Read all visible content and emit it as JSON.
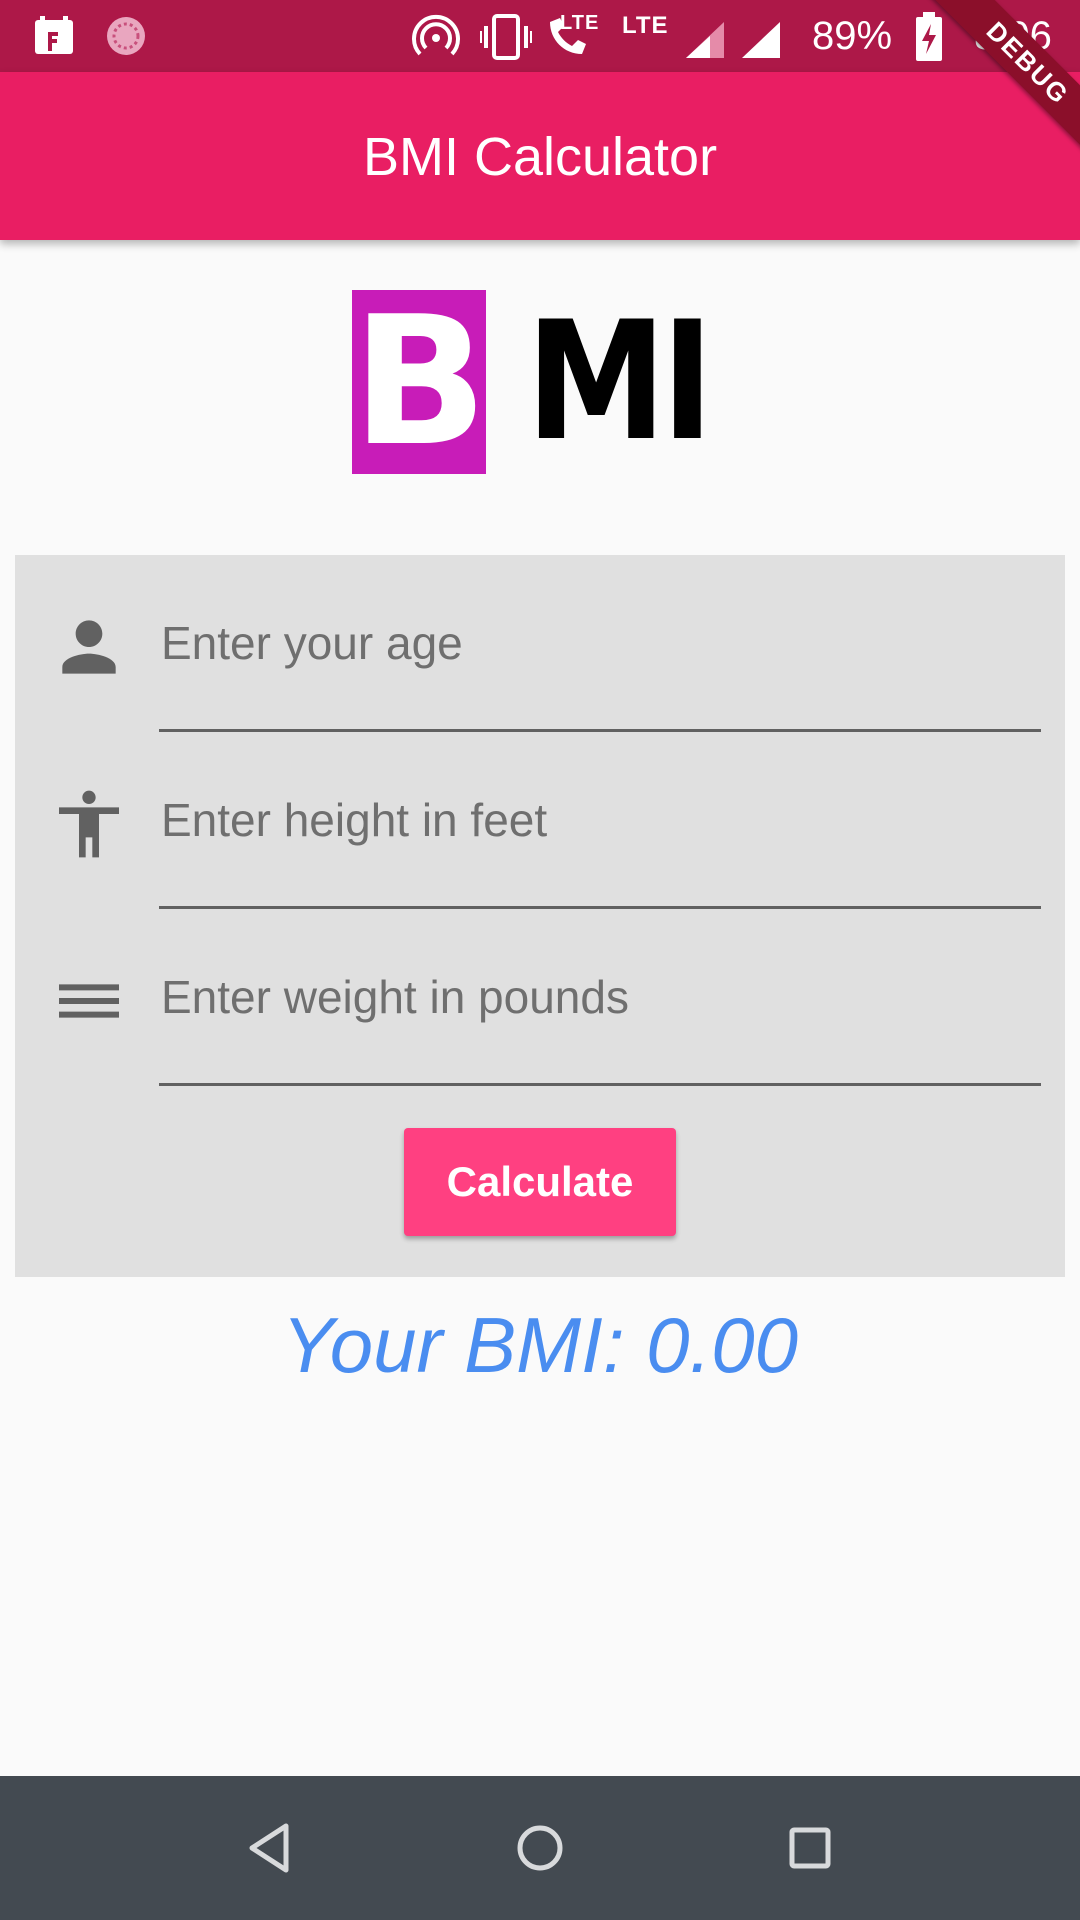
{
  "status_bar": {
    "battery_percent": "89%",
    "time": "8:06",
    "network_labels": [
      "LTE",
      "LTE"
    ]
  },
  "debug_banner": {
    "label": "DEBUG"
  },
  "app_bar": {
    "title": "BMI Calculator"
  },
  "logo": {
    "letter_b": "B",
    "letters_mi": "MI"
  },
  "form": {
    "fields": [
      {
        "placeholder": "Enter your age",
        "value": "",
        "icon": "person-icon"
      },
      {
        "placeholder": "Enter height in feet",
        "value": "",
        "icon": "accessibility-icon"
      },
      {
        "placeholder": "Enter weight in pounds",
        "value": "",
        "icon": "menu-lines-icon"
      }
    ],
    "calculate_label": "Calculate"
  },
  "result": {
    "text": "Your BMI: 0.00"
  },
  "colors": {
    "status_bar": "#ad1848",
    "app_bar": "#e91e63",
    "button": "#ff4081",
    "result_text": "#4a8df0",
    "logo_b_background": "#c81cb8",
    "nav_bar": "#434a51"
  },
  "nav_bar": {
    "buttons": [
      "back-icon",
      "home-icon",
      "recents-icon"
    ]
  }
}
